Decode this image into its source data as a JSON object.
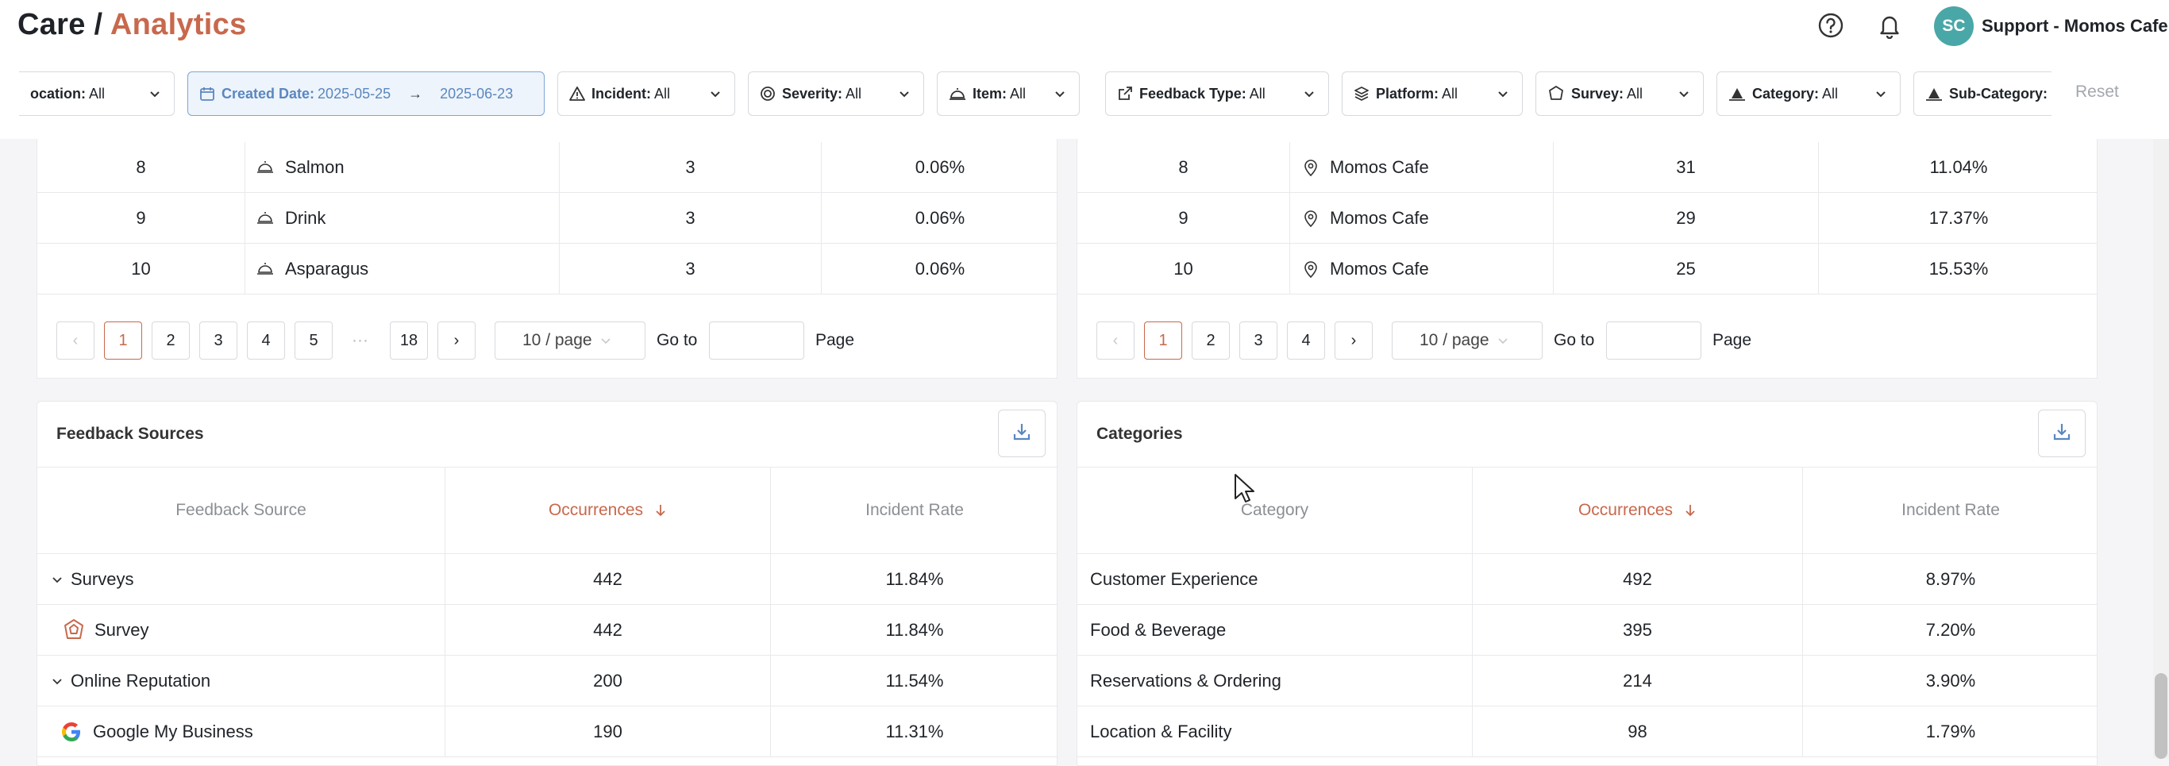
{
  "header": {
    "title_prefix": "Care /",
    "title_accent": "Analytics",
    "avatar_initials": "SC",
    "user_name": "Support - Momos Cafe",
    "accent_color": "#c8684c"
  },
  "filters": [
    {
      "key": "ocation:",
      "value": "All",
      "icon": "location-icon"
    },
    {
      "key": "Created Date:",
      "from": "2025-05-25",
      "arrow": "→",
      "to": "2025-06-23",
      "icon": "calendar-icon"
    },
    {
      "key": "Incident:",
      "value": "All",
      "icon": "warning-icon"
    },
    {
      "key": "Severity:",
      "value": "All",
      "icon": "target-icon"
    },
    {
      "key": "Item:",
      "value": "All",
      "icon": "cloche-icon"
    },
    {
      "key": "Feedback Type:",
      "value": "All",
      "icon": "external-link-icon"
    },
    {
      "key": "Platform:",
      "value": "All",
      "icon": "layers-icon"
    },
    {
      "key": "Survey:",
      "value": "All",
      "icon": "survey-icon"
    },
    {
      "key": "Category:",
      "value": "All",
      "icon": "category-icon"
    },
    {
      "key": "Sub-Category:",
      "value": "",
      "icon": "category-icon"
    }
  ],
  "reset_label": "Reset",
  "items_table": {
    "rows": [
      {
        "rank": "8",
        "name": "Salmon",
        "occ": "3",
        "rate": "0.06%"
      },
      {
        "rank": "9",
        "name": "Drink",
        "occ": "3",
        "rate": "0.06%"
      },
      {
        "rank": "10",
        "name": "Asparagus",
        "occ": "3",
        "rate": "0.06%"
      }
    ],
    "pages": [
      "1",
      "2",
      "3",
      "4",
      "5"
    ],
    "ellipsis": "···",
    "last_page": "18",
    "page_size": "10 / page",
    "goto_label": "Go to",
    "page_label": "Page"
  },
  "locations_table": {
    "rows": [
      {
        "rank": "8",
        "name": "Momos Cafe",
        "occ": "31",
        "rate": "11.04%"
      },
      {
        "rank": "9",
        "name": "Momos Cafe",
        "occ": "29",
        "rate": "17.37%"
      },
      {
        "rank": "10",
        "name": "Momos Cafe",
        "occ": "25",
        "rate": "15.53%"
      }
    ],
    "pages": [
      "1",
      "2",
      "3",
      "4"
    ],
    "page_size": "10 / page",
    "goto_label": "Go to",
    "page_label": "Page"
  },
  "feedback_sources": {
    "title": "Feedback Sources",
    "columns": [
      "Feedback Source",
      "Occurrences",
      "Incident Rate"
    ],
    "rows": [
      {
        "label": "Surveys",
        "occ": "442",
        "rate": "11.84%"
      },
      {
        "label": "Survey",
        "occ": "442",
        "rate": "11.84%"
      },
      {
        "label": "Online Reputation",
        "occ": "200",
        "rate": "11.54%"
      },
      {
        "label": "Google My Business",
        "occ": "190",
        "rate": "11.31%"
      }
    ]
  },
  "categories": {
    "title": "Categories",
    "columns": [
      "Category",
      "Occurrences",
      "Incident Rate"
    ],
    "rows": [
      {
        "label": "Customer Experience",
        "occ": "492",
        "rate": "8.97%"
      },
      {
        "label": "Food & Beverage",
        "occ": "395",
        "rate": "7.20%"
      },
      {
        "label": "Reservations & Ordering",
        "occ": "214",
        "rate": "3.90%"
      },
      {
        "label": "Location & Facility",
        "occ": "98",
        "rate": "1.79%"
      }
    ]
  }
}
